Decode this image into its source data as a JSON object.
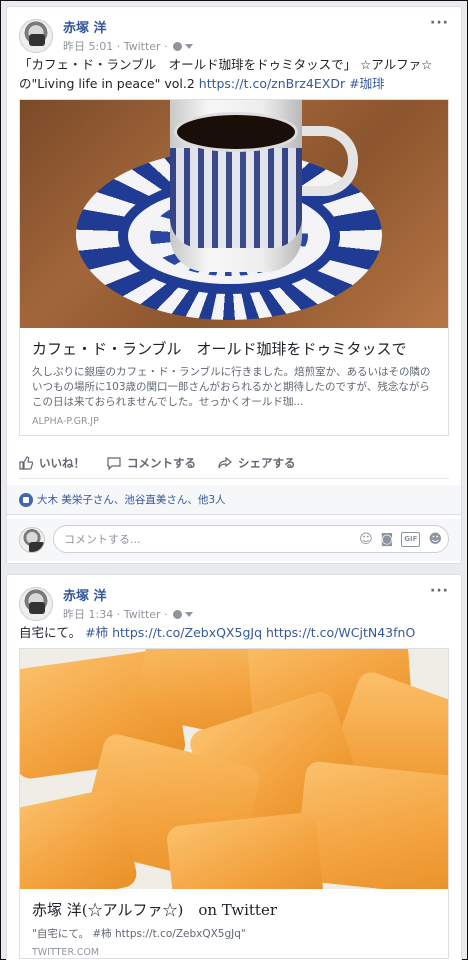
{
  "posts": [
    {
      "author": "赤塚 洋",
      "time": "昨日 5:01",
      "source": "Twitter",
      "text_quote": "「カフェ・ド・ランブル　オールド珈琲をドゥミタッスで」 ☆アルファ☆",
      "text_line2": "の\"Living life in peace\" vol.2 ",
      "link1": "https://t.co/znBrz4EXDr",
      "tag": "#珈琲",
      "card": {
        "title": "カフェ・ド・ランブル　オールド珈琲をドゥミタッスで",
        "desc": "久しぶりに銀座のカフェ・ド・ランブルに行きました。焙煎室か、あるいはその隣のいつもの場所に103歳の関口一郎さんがおられるかと期待したのですが、残念ながらこの日は来ておられませんでした。せっかくオールド珈...",
        "domain": "ALPHA-P.GR.JP"
      },
      "actions": {
        "like": "いいね！",
        "comment": "コメントする",
        "share": "シェアする"
      },
      "likes": "大木 美栄子さん、池谷直美さん、他3人",
      "comment_placeholder": "コメントする..."
    },
    {
      "author": "赤塚 洋",
      "time": "昨日 1:34",
      "source": "Twitter",
      "text_prefix": "自宅にて。",
      "tag": "#柿",
      "link1": "https://t.co/ZebxQX5gJq",
      "link2": "https://t.co/WCjtN43fnO",
      "card": {
        "title": "赤塚 洋(☆アルファ☆)　on Twitter",
        "desc": "\"自宅にて。 #柿 https://t.co/ZebxQX5gJq\"",
        "domain": "TWITTER.COM"
      }
    }
  ],
  "icons": {
    "more": "more-dots-icon",
    "globe": "globe-icon"
  },
  "colors": {
    "link": "#365899",
    "bg": "#e9ebee"
  }
}
